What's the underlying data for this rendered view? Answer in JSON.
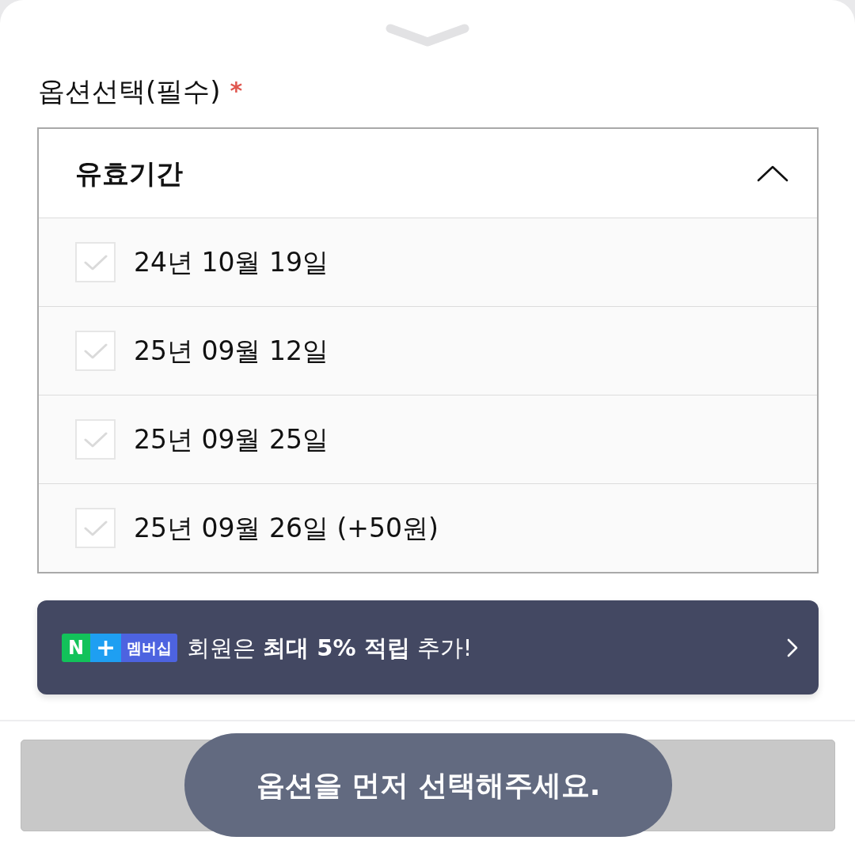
{
  "option_label": {
    "text": "옵션선택(필수)",
    "required_mark": "*"
  },
  "dropdown": {
    "title": "유효기간",
    "expanded": true,
    "options": [
      {
        "label": "24년 10월 19일",
        "checked": false
      },
      {
        "label": "25년 09월 12일",
        "checked": false
      },
      {
        "label": "25년 09월 25일",
        "checked": false
      },
      {
        "label": "25년 09월 26일 (+50원)",
        "checked": false
      }
    ]
  },
  "membership_banner": {
    "badge": {
      "letter": "N",
      "plus": "+",
      "label": "멤버십"
    },
    "text": "회원은 **최대 5% 적립** 추가!"
  },
  "bottom_button": {
    "disabled": true
  },
  "toast": {
    "message": "옵션을 먼저 선택해주세요."
  }
}
